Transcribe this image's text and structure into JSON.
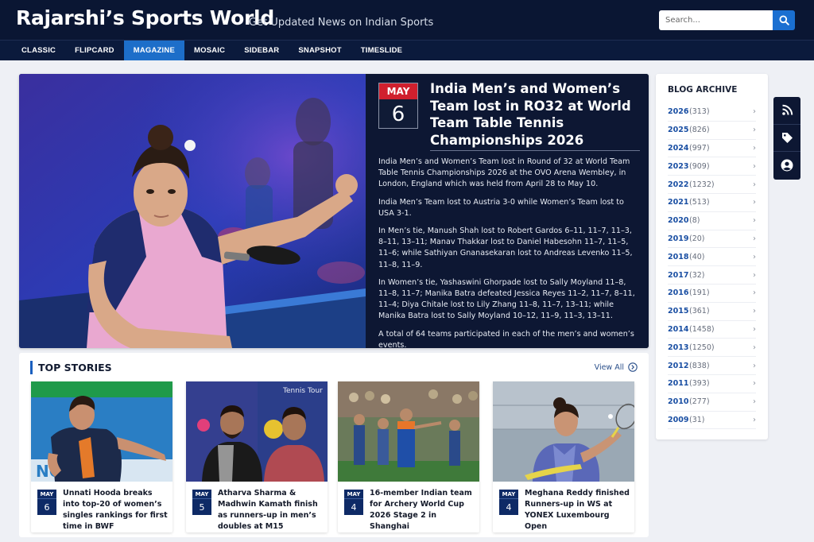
{
  "site": {
    "title": "Rajarshi’s Sports World",
    "tagline": "Get Updated News on Indian Sports"
  },
  "search": {
    "placeholder": "Search..."
  },
  "nav": {
    "items": [
      "CLASSIC",
      "FLIPCARD",
      "MAGAZINE",
      "MOSAIC",
      "SIDEBAR",
      "SNAPSHOT",
      "TIMESLIDE"
    ],
    "active": "MAGAZINE"
  },
  "featured": {
    "month": "MAY",
    "day": "6",
    "title": "India Men’s and Women’s Team lost in RO32 at World Team Table Tennis Championships 2026",
    "paragraphs": [
      "India Men’s and Women’s Team lost in Round of 32 at World Team Table Tennis Championships 2026 at the OVO Arena Wembley, in London, England which was held from April 28 to May 10.",
      "India Men’s Team lost to Austria 3-0 while Women’s Team lost to USA 3-1.",
      "In Men’s tie, Manush Shah lost to Robert Gardos 6–11, 11–7, 11–3, 8–11, 13–11; Manav Thakkar lost to Daniel Habesohn 11–7, 11–5, 11–6; while Sathiyan Gnanasekaran lost to Andreas Levenko 11–5, 11–8, 11–9.",
      "In Women’s tie, Yashaswini Ghorpade lost to Sally Moyland 11–8, 11–8, 11–7; Manika Batra defeated Jessica Reyes 11–2, 11–7, 8–11, 11–4; Diya Chitale lost to Lily Zhang 11–8, 11–7, 13–11; while Manika Batra lost to Sally Moyland 10–12, 11–9, 11–3, 13–11.",
      "A total of 64 teams participated in each of the men’s and women’s events."
    ]
  },
  "top_stories": {
    "heading": "TOP STORIES",
    "view_all": "View All",
    "items": [
      {
        "month": "MAY",
        "day": "6",
        "title": "Unnati Hooda breaks into top-20 of women’s singles rankings for first time in BWF",
        "img_text": "NOX"
      },
      {
        "month": "MAY",
        "day": "5",
        "title": "Atharva Sharma & Madhwin Kamath finish as runners-up in men’s doubles at M15",
        "img_text": "Tennis Tour"
      },
      {
        "month": "MAY",
        "day": "4",
        "title": "16-member Indian team for Archery World Cup 2026 Stage 2 in Shanghai",
        "img_text": ""
      },
      {
        "month": "MAY",
        "day": "4",
        "title": "Meghana Reddy finished Runners-up in WS at YONEX Luxembourg Open",
        "img_text": ""
      }
    ]
  },
  "archive": {
    "title": "BLOG ARCHIVE",
    "years": [
      {
        "year": "2026",
        "count": "(313)"
      },
      {
        "year": "2025",
        "count": "(826)"
      },
      {
        "year": "2024",
        "count": "(997)"
      },
      {
        "year": "2023",
        "count": "(909)"
      },
      {
        "year": "2022",
        "count": "(1232)"
      },
      {
        "year": "2021",
        "count": "(513)"
      },
      {
        "year": "2020",
        "count": "(8)"
      },
      {
        "year": "2019",
        "count": "(20)"
      },
      {
        "year": "2018",
        "count": "(40)"
      },
      {
        "year": "2017",
        "count": "(32)"
      },
      {
        "year": "2016",
        "count": "(191)"
      },
      {
        "year": "2015",
        "count": "(361)"
      },
      {
        "year": "2014",
        "count": "(1458)"
      },
      {
        "year": "2013",
        "count": "(1250)"
      },
      {
        "year": "2012",
        "count": "(838)"
      },
      {
        "year": "2011",
        "count": "(393)"
      },
      {
        "year": "2010",
        "count": "(277)"
      },
      {
        "year": "2009",
        "count": "(31)"
      }
    ]
  },
  "side_tools": [
    "rss-icon",
    "tag-icon",
    "user-icon"
  ],
  "colors": {
    "header_bg": "#0a1633",
    "accent_blue": "#1d6ec9",
    "date_red": "#d0202e",
    "badge_navy": "#0e2a66"
  }
}
